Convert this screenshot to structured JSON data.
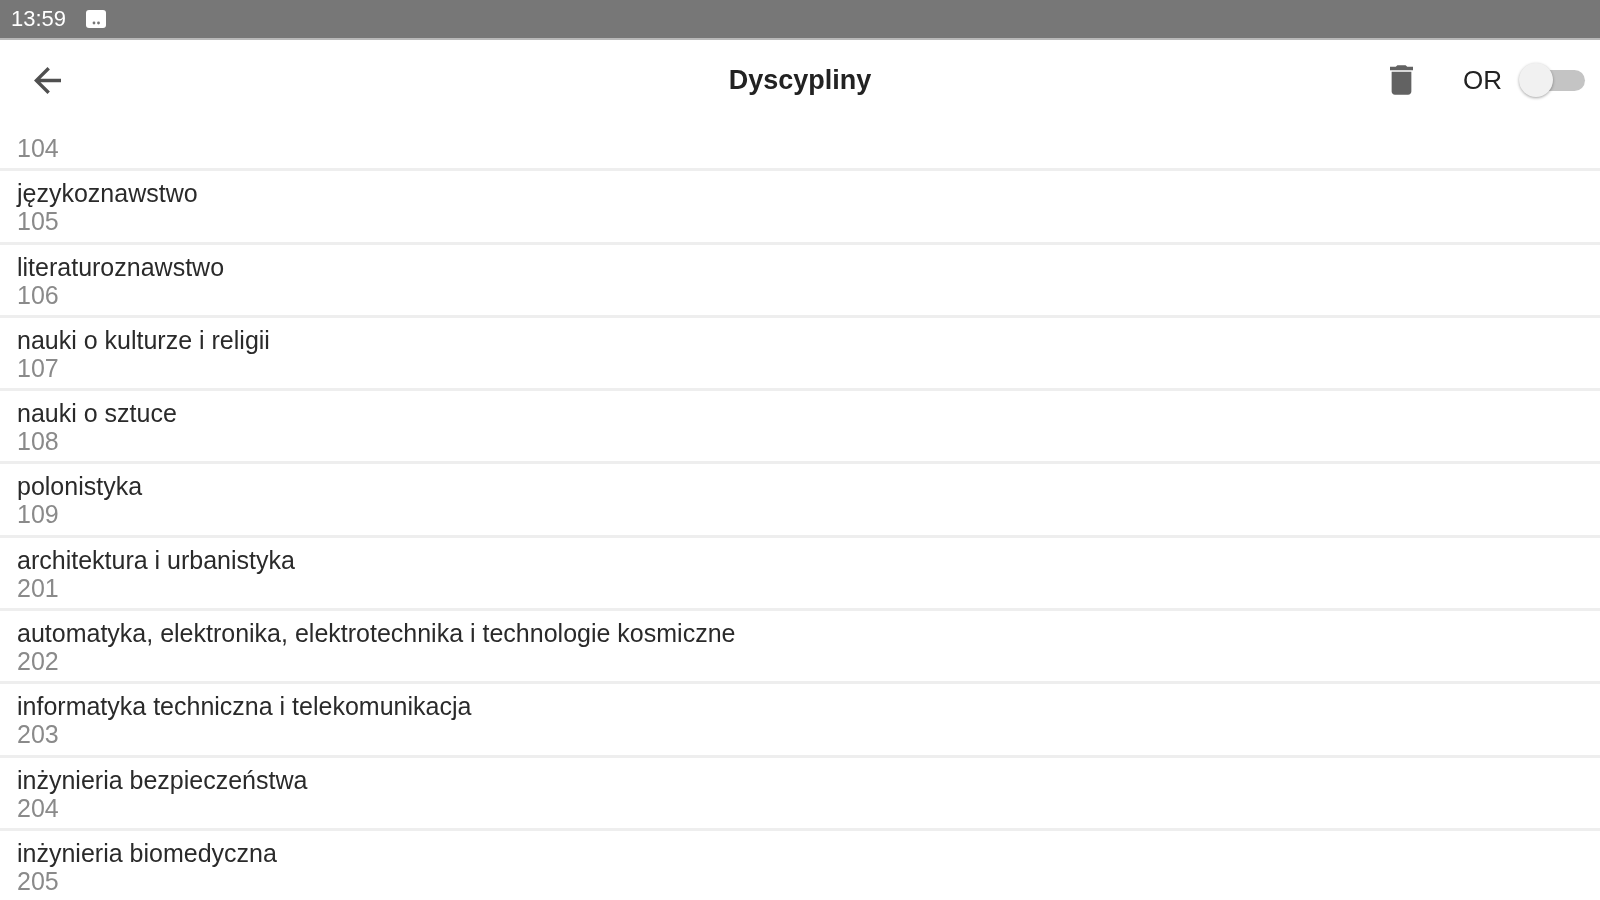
{
  "status_bar": {
    "time": "13:59"
  },
  "app_bar": {
    "title": "Dyscypliny",
    "toggle": {
      "label": "OR",
      "on": false
    }
  },
  "list": [
    {
      "number": "104"
    },
    {
      "title": "językoznawstwo",
      "number": "105"
    },
    {
      "title": "literaturoznawstwo",
      "number": "106"
    },
    {
      "title": "nauki o kulturze i religii",
      "number": "107"
    },
    {
      "title": "nauki o sztuce",
      "number": "108"
    },
    {
      "title": "polonistyka",
      "number": "109"
    },
    {
      "title": "architektura i urbanistyka",
      "number": "201"
    },
    {
      "title": "automatyka, elektronika, elektrotechnika i technologie kosmiczne",
      "number": "202"
    },
    {
      "title": "informatyka techniczna i telekomunikacja",
      "number": "203"
    },
    {
      "title": "inżynieria bezpieczeństwa",
      "number": "204"
    },
    {
      "title": "inżynieria biomedyczna",
      "number": "205"
    }
  ]
}
